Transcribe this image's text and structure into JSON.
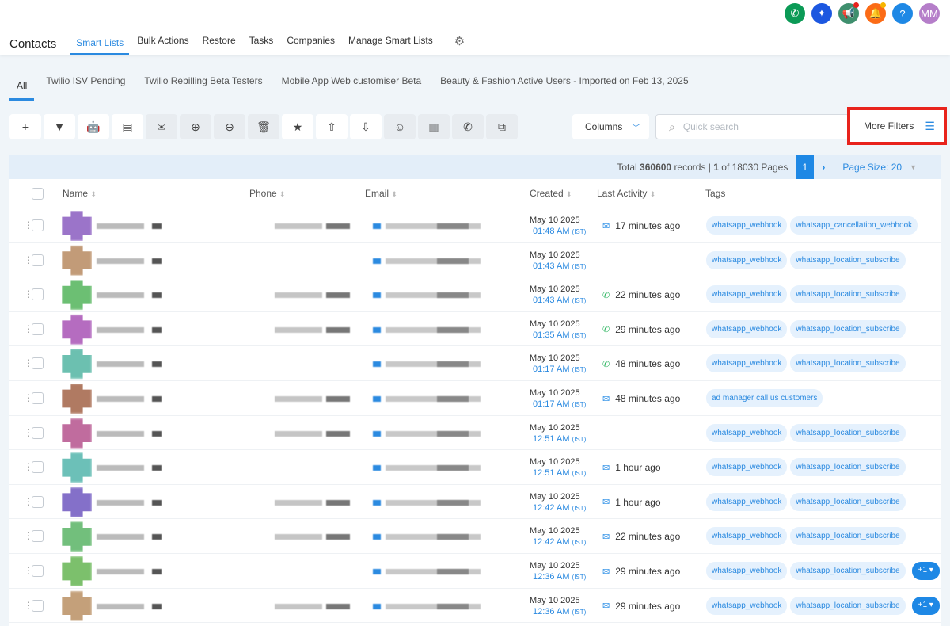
{
  "header": {
    "title": "Contacts",
    "tabs": [
      "Smart Lists",
      "Bulk Actions",
      "Restore",
      "Tasks",
      "Companies",
      "Manage Smart Lists"
    ],
    "active_tab": 0,
    "avatar": "MM",
    "icons": [
      {
        "name": "phone-icon",
        "color": "#0b9a56",
        "glyph": "✆"
      },
      {
        "name": "sparkle-icon",
        "color": "#1c57e0",
        "glyph": "✦"
      },
      {
        "name": "megaphone-icon",
        "color": "#3f8f6e",
        "glyph": "📢"
      },
      {
        "name": "bell-icon",
        "color": "#fb6b16",
        "glyph": "🔔"
      },
      {
        "name": "help-icon",
        "color": "#1e88e5",
        "glyph": "?"
      }
    ]
  },
  "smart_lists": [
    "All",
    "Twilio ISV Pending",
    "Twilio Rebilling Beta Testers",
    "Mobile App Web customiser Beta",
    "Beauty & Fashion Active Users - Imported on Feb 13, 2025"
  ],
  "toolbar": {
    "buttons": [
      "add",
      "filter",
      "bot",
      "sms",
      "email",
      "add-tag",
      "remove-tag",
      "delete",
      "star",
      "export",
      "import",
      "review",
      "company",
      "whatsapp",
      "duplicate"
    ],
    "columns_label": "Columns",
    "search_placeholder": "Quick search",
    "more_filters_label": "More Filters"
  },
  "pagination": {
    "total_prefix": "Total",
    "total": "360600",
    "records_mid": "records |",
    "page": "1",
    "of_text": "of 18030 Pages",
    "current": "1",
    "page_size": "Page Size: 20"
  },
  "table": {
    "headers": [
      "Name",
      "Phone",
      "Email",
      "Created",
      "Last Activity",
      "Tags"
    ],
    "rows": [
      {
        "date": "May 10 2025",
        "time": "01:48 AM",
        "tz": "(IST)",
        "activity_icon": "email",
        "activity": "17 minutes ago",
        "tags": [
          "whatsapp_webhook",
          "whatsapp_cancellation_webhook"
        ],
        "more": "",
        "avatar_color": "#9b74c9"
      },
      {
        "date": "May 10 2025",
        "time": "01:43 AM",
        "tz": "(IST)",
        "activity_icon": "",
        "activity": "",
        "tags": [
          "whatsapp_webhook",
          "whatsapp_location_subscribe"
        ],
        "more": "",
        "avatar_color": "#c29b78"
      },
      {
        "date": "May 10 2025",
        "time": "01:43 AM",
        "tz": "(IST)",
        "activity_icon": "whatsapp",
        "activity": "22 minutes ago",
        "tags": [
          "whatsapp_webhook",
          "whatsapp_location_subscribe"
        ],
        "more": "",
        "avatar_color": "#6cbf73"
      },
      {
        "date": "May 10 2025",
        "time": "01:35 AM",
        "tz": "(IST)",
        "activity_icon": "whatsapp",
        "activity": "29 minutes ago",
        "tags": [
          "whatsapp_webhook",
          "whatsapp_location_subscribe"
        ],
        "more": "",
        "avatar_color": "#b56cc0"
      },
      {
        "date": "May 10 2025",
        "time": "01:17 AM",
        "tz": "(IST)",
        "activity_icon": "whatsapp",
        "activity": "48 minutes ago",
        "tags": [
          "whatsapp_webhook",
          "whatsapp_location_subscribe"
        ],
        "more": "",
        "avatar_color": "#6cc0b0"
      },
      {
        "date": "May 10 2025",
        "time": "01:17 AM",
        "tz": "(IST)",
        "activity_icon": "email",
        "activity": "48 minutes ago",
        "tags": [
          "ad manager call us customers"
        ],
        "more": "",
        "avatar_color": "#b07a62"
      },
      {
        "date": "May 10 2025",
        "time": "12:51 AM",
        "tz": "(IST)",
        "activity_icon": "",
        "activity": "",
        "tags": [
          "whatsapp_webhook",
          "whatsapp_location_subscribe"
        ],
        "more": "",
        "avatar_color": "#c06c9e"
      },
      {
        "date": "May 10 2025",
        "time": "12:51 AM",
        "tz": "(IST)",
        "activity_icon": "email",
        "activity": "1 hour ago",
        "tags": [
          "whatsapp_webhook",
          "whatsapp_location_subscribe"
        ],
        "more": "",
        "avatar_color": "#6cc0b8"
      },
      {
        "date": "May 10 2025",
        "time": "12:42 AM",
        "tz": "(IST)",
        "activity_icon": "email",
        "activity": "1 hour ago",
        "tags": [
          "whatsapp_webhook",
          "whatsapp_location_subscribe"
        ],
        "more": "",
        "avatar_color": "#8470c9"
      },
      {
        "date": "May 10 2025",
        "time": "12:42 AM",
        "tz": "(IST)",
        "activity_icon": "email",
        "activity": "22 minutes ago",
        "tags": [
          "whatsapp_webhook",
          "whatsapp_location_subscribe"
        ],
        "more": "",
        "avatar_color": "#72bf7c"
      },
      {
        "date": "May 10 2025",
        "time": "12:36 AM",
        "tz": "(IST)",
        "activity_icon": "email",
        "activity": "29 minutes ago",
        "tags": [
          "whatsapp_webhook",
          "whatsapp_location_subscribe"
        ],
        "more": "+1 ▾",
        "avatar_color": "#7cc06c"
      },
      {
        "date": "May 10 2025",
        "time": "12:36 AM",
        "tz": "(IST)",
        "activity_icon": "email",
        "activity": "29 minutes ago",
        "tags": [
          "whatsapp_webhook",
          "whatsapp_location_subscribe"
        ],
        "more": "+1 ▾",
        "avatar_color": "#c4a07a"
      }
    ]
  }
}
